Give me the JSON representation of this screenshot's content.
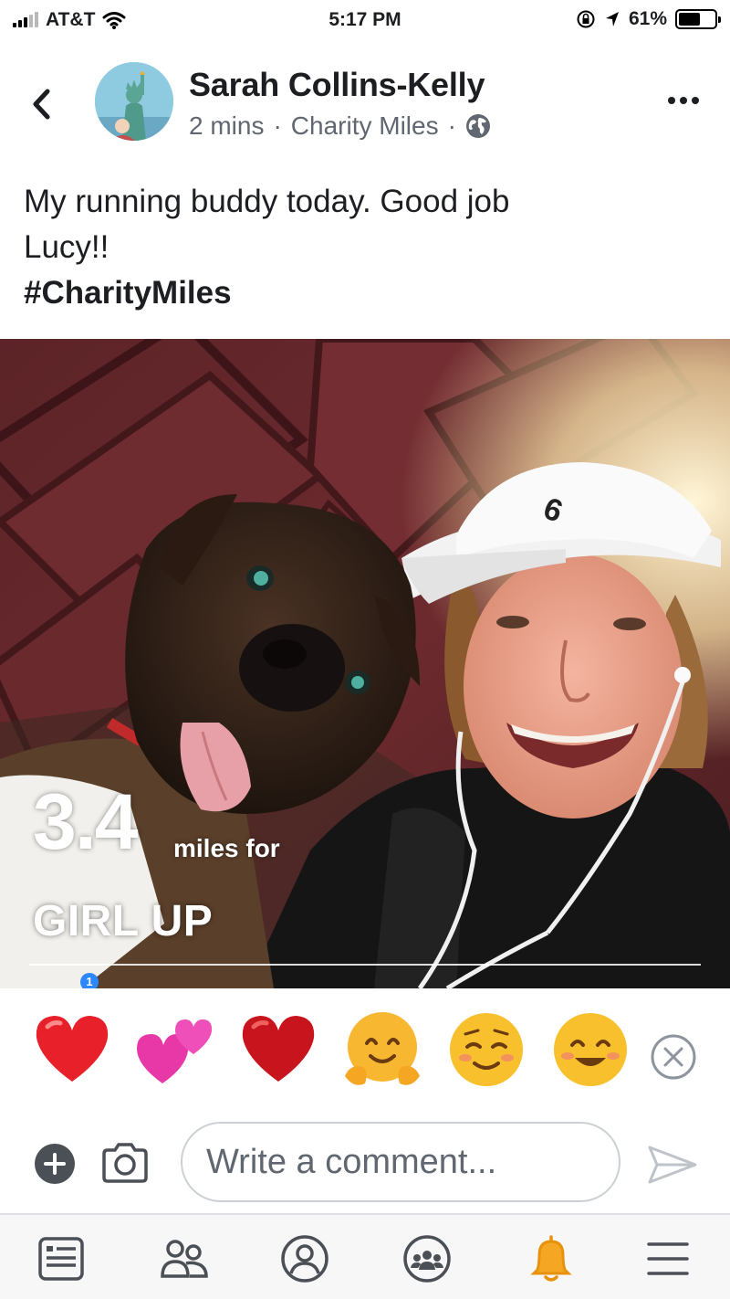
{
  "status_bar": {
    "carrier": "AT&T",
    "time": "5:17 PM",
    "battery": "61%",
    "battery_level": 0.61
  },
  "post": {
    "author": "Sarah Collins-Kelly",
    "time_ago": "2 mins",
    "separator": "·",
    "app": "Charity Miles",
    "privacy_icon": "globe-icon",
    "caption_line1": "My running buddy today.  Good job",
    "caption_line2": "Lucy!!",
    "hashtag": "#CharityMiles"
  },
  "photo": {
    "distance": "3.4",
    "unit": "miles for",
    "charity": "GIRL UP",
    "badge": "1"
  },
  "reactions": [
    "red-heart-emoji",
    "two-hearts-emoji",
    "dark-red-heart-emoji",
    "hugging-face-emoji",
    "smiling-face-emoji",
    "grinning-face-emoji"
  ],
  "comment": {
    "placeholder": "Write a comment..."
  },
  "tabs": [
    "news-feed-icon",
    "friends-icon",
    "profile-icon",
    "groups-icon",
    "notifications-icon",
    "menu-icon"
  ],
  "colors": {
    "accent": "#1877f2",
    "text": "#1c1e21",
    "secondary_text": "#606770",
    "notification_bell": "#f5a623"
  }
}
